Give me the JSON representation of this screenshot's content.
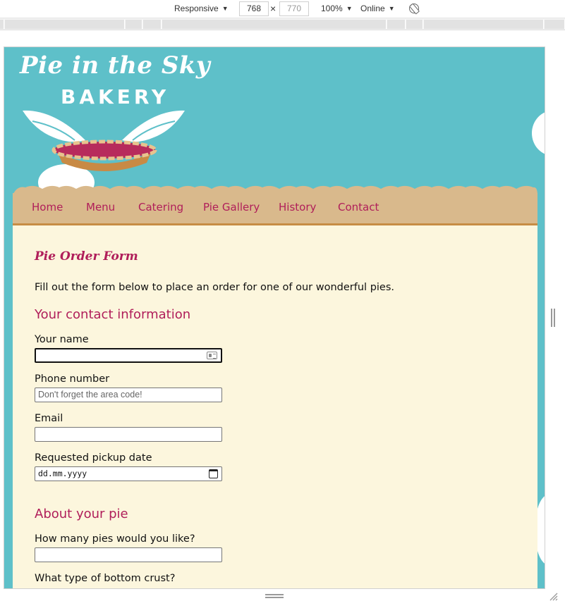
{
  "devtools": {
    "device_mode": "Responsive",
    "width": "768",
    "height": "770",
    "zoom": "100%",
    "network": "Online"
  },
  "logo": {
    "title": "Pie in the Sky",
    "subtitle": "BAKERY"
  },
  "nav": {
    "items": [
      "Home",
      "Menu",
      "Catering",
      "Pie Gallery",
      "History",
      "Contact"
    ]
  },
  "form": {
    "title": "Pie Order Form",
    "intro": "Fill out the form below to place an order for one of our wonderful pies.",
    "sections": {
      "contact": "Your contact information",
      "pie": "About your pie"
    },
    "fields": {
      "name_label": "Your name",
      "name_value": "",
      "phone_label": "Phone number",
      "phone_placeholder": "Don't forget the area code!",
      "email_label": "Email",
      "email_value": "",
      "date_label": "Requested pickup date",
      "date_placeholder": "dd.mm.yyyy",
      "quantity_label": "How many pies would you like?",
      "quantity_value": "",
      "crust_label": "What type of bottom crust?"
    }
  },
  "colors": {
    "sky": "#5ec0c9",
    "nav_bg": "#d9b98c",
    "nav_border": "#c78c44",
    "accent": "#b01e5a",
    "content_bg": "#fcf6dd"
  }
}
